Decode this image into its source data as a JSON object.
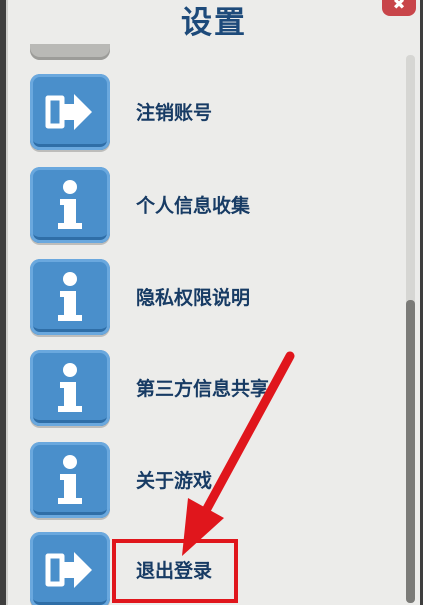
{
  "header": {
    "title": "设置",
    "close_symbol": "✖"
  },
  "items": [
    {
      "label": "注销账号",
      "icon": "logout-arrow-icon"
    },
    {
      "label": "个人信息收集",
      "icon": "info-icon"
    },
    {
      "label": "隐私权限说明",
      "icon": "info-icon"
    },
    {
      "label": "第三方信息共享",
      "icon": "info-icon"
    },
    {
      "label": "关于游戏",
      "icon": "info-icon"
    },
    {
      "label": "退出登录",
      "icon": "logout-arrow-icon"
    }
  ],
  "annotation": {
    "color": "#e0161c",
    "target": "退出登录"
  },
  "colors": {
    "tile": "#4a8fcb",
    "label": "#173b64",
    "title": "#1d4a7a",
    "panel": "#ececea"
  }
}
